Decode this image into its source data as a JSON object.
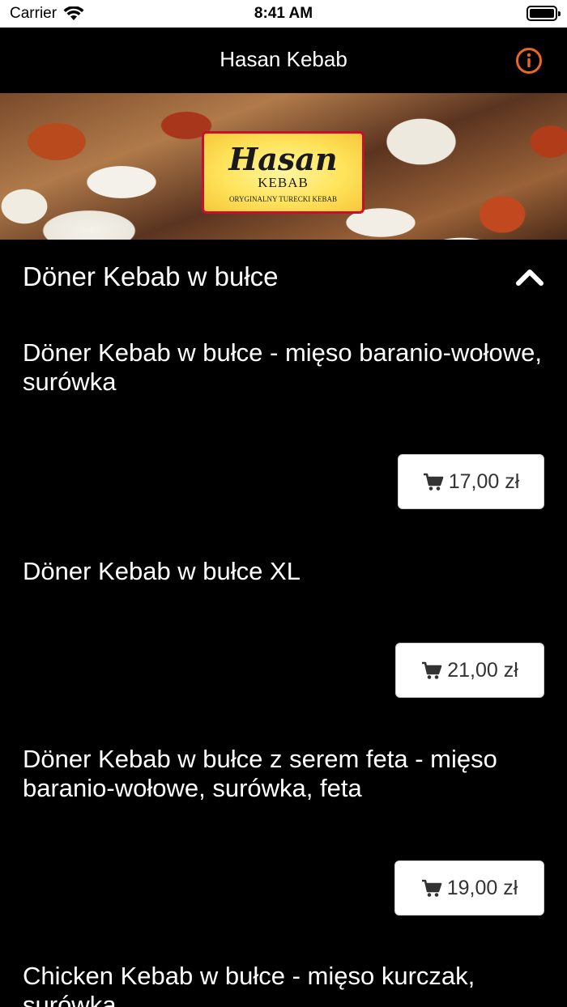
{
  "status_bar": {
    "carrier": "Carrier",
    "time": "8:41 AM"
  },
  "nav": {
    "title": "Hasan Kebab",
    "accent_color": "#e8681f"
  },
  "logo": {
    "name": "Hasan",
    "sub": "KEBAB",
    "tagline": "ORYGINALNY TURECKI KEBAB"
  },
  "section": {
    "title": "Döner Kebab w bułce",
    "icon": "chevron-up-icon"
  },
  "items": [
    {
      "name": "Döner Kebab w bułce - mięso baranio-wołowe, surówka",
      "price": "17,00 zł"
    },
    {
      "name": "Döner Kebab w bułce XL",
      "price": "21,00 zł"
    },
    {
      "name": "Döner Kebab w bułce z serem feta - mięso baranio-wołowe, surówka, feta",
      "price": "19,00 zł"
    },
    {
      "name": "Chicken Kebab w bułce - mięso kurczak, surówka"
    }
  ]
}
